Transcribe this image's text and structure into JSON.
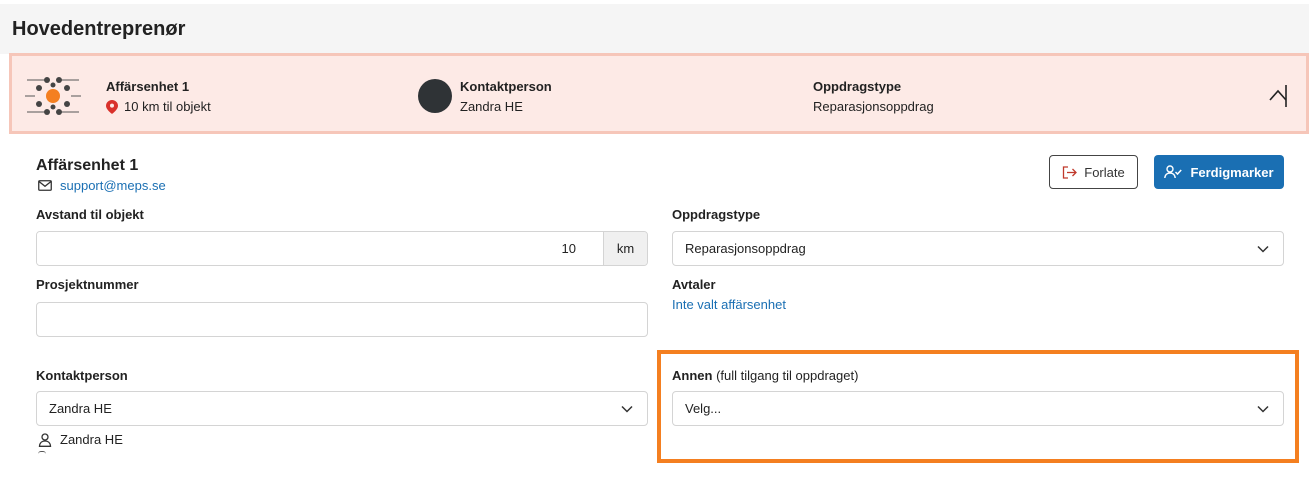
{
  "page": {
    "title": "Hovedentreprenør"
  },
  "summary": {
    "unit_name": "Affärsenhet 1",
    "distance_text": "10 km til objekt",
    "contact_label": "Kontaktperson",
    "contact_value": "Zandra HE",
    "type_label": "Oppdragstype",
    "type_value": "Reparasjonsoppdrag",
    "icons": [
      "company-logo",
      "location-pin-icon",
      "avatar",
      "chevron-up-icon"
    ]
  },
  "details": {
    "unit_heading": "Affärsenhet 1",
    "email": "support@meps.se",
    "leave_button": "Forlate",
    "complete_button": "Ferdigmarker",
    "distance_label": "Avstand til objekt",
    "distance_value": "10",
    "distance_unit": "km",
    "project_label": "Prosjektnummer",
    "project_value": "",
    "contact_label": "Kontaktperson",
    "contact_selected": "Zandra HE",
    "contact_person_name": "Zandra HE",
    "type_label": "Oppdragstype",
    "type_selected": "Reparasjonsoppdrag",
    "agreements_label": "Avtaler",
    "agreements_link": "Inte valt affärsenhet",
    "other_label_bold": "Annen",
    "other_label_note": "(full tilgang til oppdraget)",
    "other_placeholder": "Velg..."
  },
  "colors": {
    "summary_bg": "#fdeae6",
    "summary_border": "#f6c6b9",
    "primary": "#1a6fb3",
    "highlight": "#f47f20",
    "pin": "#d9312b",
    "leave_icon": "#c0392b"
  }
}
